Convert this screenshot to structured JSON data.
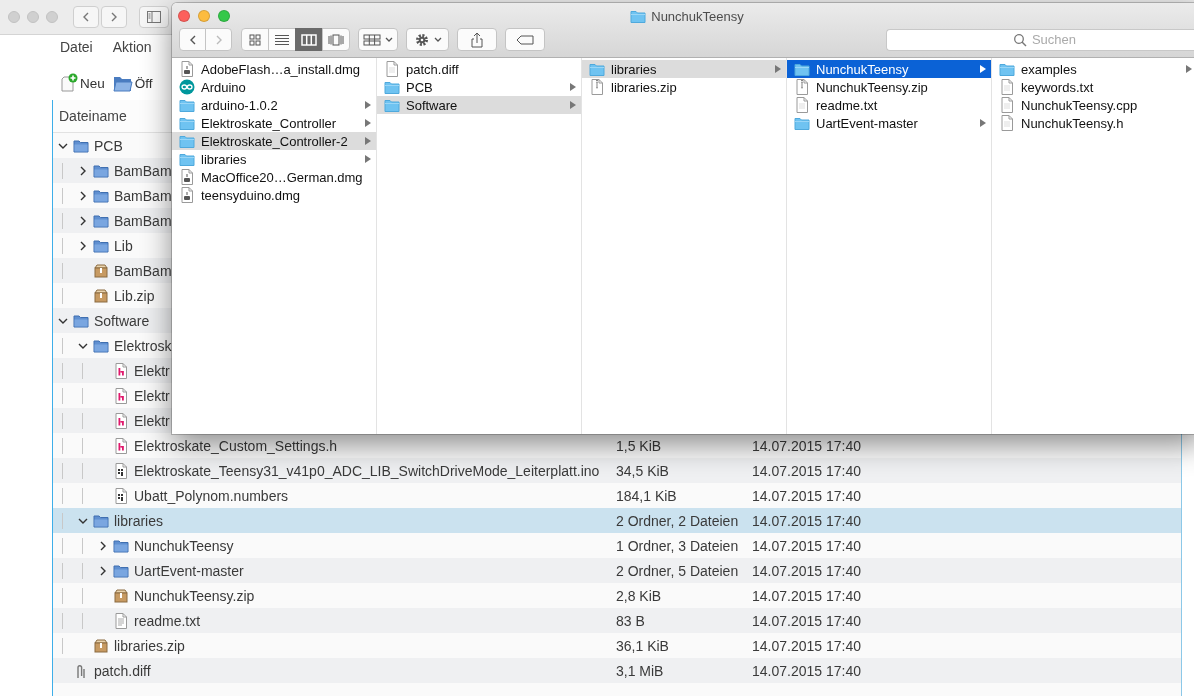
{
  "back_window": {
    "menu": [
      "Datei",
      "Aktion"
    ],
    "toolbar": [
      {
        "label": "Neu",
        "kind": "new"
      },
      {
        "label": "Öff",
        "kind": "open"
      }
    ],
    "tree": {
      "columns": [
        "Dateiname"
      ],
      "rows": [
        {
          "name": "PCB",
          "kind": "folder",
          "expanded": true,
          "selected": false,
          "children": [
            {
              "name": "BamBam",
              "kind": "folder",
              "expanded": false,
              "selected": false
            },
            {
              "name": "BamBam",
              "kind": "folder",
              "expanded": false,
              "selected": false
            },
            {
              "name": "BamBam",
              "kind": "folder",
              "expanded": false,
              "selected": false
            },
            {
              "name": "Lib",
              "kind": "folder",
              "expanded": false,
              "selected": false
            },
            {
              "name": "BamBam",
              "kind": "archive",
              "selected": false
            },
            {
              "name": "Lib.zip",
              "kind": "archive",
              "selected": false
            }
          ]
        },
        {
          "name": "Software",
          "kind": "folder",
          "expanded": true,
          "selected": false,
          "children": [
            {
              "name": "Elektrosk",
              "kind": "folder",
              "expanded": true,
              "selected": false,
              "children": [
                {
                  "name": "Elektr",
                  "kind": "header",
                  "selected": false
                },
                {
                  "name": "Elektr",
                  "kind": "header",
                  "selected": false
                },
                {
                  "name": "Elektr",
                  "kind": "header",
                  "selected": false
                },
                {
                  "name": "Elektroskate_Custom_Settings.h",
                  "kind": "header",
                  "selected": false,
                  "size": "1,5 KiB",
                  "modified": "14.07.2015 17:40"
                },
                {
                  "name": "Elektroskate_Teensy31_v41p0_ADC_LIB_SwitchDriveMode_Leiterplatt.ino",
                  "kind": "source",
                  "selected": false,
                  "size": "34,5 KiB",
                  "modified": "14.07.2015 17:40"
                },
                {
                  "name": "Ubatt_Polynom.numbers",
                  "kind": "source",
                  "selected": false,
                  "size": "184,1 KiB",
                  "modified": "14.07.2015 17:40"
                }
              ]
            },
            {
              "name": "libraries",
              "kind": "folder",
              "expanded": true,
              "selected": true,
              "size": "2 Ordner, 2 Dateien",
              "modified": "14.07.2015 17:40",
              "children": [
                {
                  "name": "NunchukTeensy",
                  "kind": "folder",
                  "expanded": false,
                  "selected": false,
                  "size": "1 Ordner, 3 Dateien",
                  "modified": "14.07.2015 17:40"
                },
                {
                  "name": "UartEvent-master",
                  "kind": "folder",
                  "expanded": false,
                  "selected": false,
                  "size": "2 Ordner, 5 Dateien",
                  "modified": "14.07.2015 17:40"
                },
                {
                  "name": "NunchukTeensy.zip",
                  "kind": "archive",
                  "selected": false,
                  "size": "2,8 KiB",
                  "modified": "14.07.2015 17:40"
                },
                {
                  "name": "readme.txt",
                  "kind": "text",
                  "selected": false,
                  "size": "83 B",
                  "modified": "14.07.2015 17:40"
                }
              ]
            },
            {
              "name": "libraries.zip",
              "kind": "archive",
              "selected": false,
              "size": "36,1 KiB",
              "modified": "14.07.2015 17:40"
            }
          ]
        },
        {
          "name": "patch.diff",
          "kind": "diff",
          "selected": false,
          "size": "3,1 MiB",
          "modified": "14.07.2015 17:40"
        }
      ]
    }
  },
  "finder": {
    "title": "NunchukTeensy",
    "view_modes": [
      {
        "kind": "icons",
        "selected": false
      },
      {
        "kind": "list",
        "selected": false
      },
      {
        "kind": "columns",
        "selected": true
      },
      {
        "kind": "coverflow",
        "selected": false
      }
    ],
    "search": {
      "placeholder": "Suchen"
    },
    "columns": [
      {
        "focused": false,
        "items": [
          {
            "name": "AdobeFlash…a_install.dmg",
            "kind": "disk-image",
            "selected": false
          },
          {
            "name": "Arduino",
            "kind": "app",
            "selected": false
          },
          {
            "name": "arduino-1.0.2",
            "kind": "folder",
            "selected": false
          },
          {
            "name": "Elektroskate_Controller",
            "kind": "folder",
            "selected": false
          },
          {
            "name": "Elektroskate_Controller-2",
            "kind": "folder",
            "selected": true
          },
          {
            "name": "libraries",
            "kind": "folder",
            "selected": false
          },
          {
            "name": "MacOffice20…German.dmg",
            "kind": "disk-image",
            "selected": false
          },
          {
            "name": "teensyduino.dmg",
            "kind": "disk-image",
            "selected": false
          }
        ]
      },
      {
        "focused": false,
        "items": [
          {
            "name": "patch.diff",
            "kind": "document",
            "selected": false
          },
          {
            "name": "PCB",
            "kind": "folder",
            "selected": false
          },
          {
            "name": "Software",
            "kind": "folder",
            "selected": true
          }
        ]
      },
      {
        "focused": false,
        "items": [
          {
            "name": "libraries",
            "kind": "folder",
            "selected": true
          },
          {
            "name": "libraries.zip",
            "kind": "archive",
            "selected": false
          }
        ]
      },
      {
        "focused": true,
        "items": [
          {
            "name": "NunchukTeensy",
            "kind": "folder",
            "selected": true
          },
          {
            "name": "NunchukTeensy.zip",
            "kind": "archive",
            "selected": false
          },
          {
            "name": "readme.txt",
            "kind": "document",
            "selected": false
          },
          {
            "name": "UartEvent-master",
            "kind": "folder",
            "selected": false
          }
        ]
      },
      {
        "items": [
          {
            "name": "examples",
            "kind": "folder",
            "selected": false
          },
          {
            "name": "keywords.txt",
            "kind": "document",
            "selected": false
          },
          {
            "name": "NunchukTeensy.cpp",
            "kind": "document",
            "selected": false
          },
          {
            "name": "NunchukTeensy.h",
            "kind": "document",
            "selected": false
          }
        ]
      }
    ]
  }
}
